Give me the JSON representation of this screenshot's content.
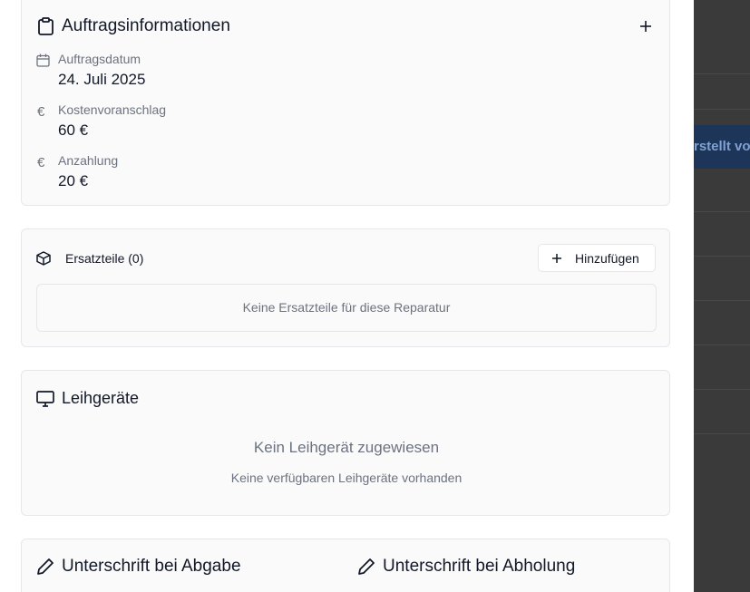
{
  "order_info": {
    "title": "Auftragsinformationen",
    "add_icon": "plus-icon",
    "fields": [
      {
        "icon": "calendar-icon",
        "label": "Auftragsdatum",
        "value": "24. Juli 2025"
      },
      {
        "icon": "euro-icon",
        "label": "Kostenvoranschlag",
        "value": "60 €"
      },
      {
        "icon": "euro-icon",
        "label": "Anzahlung",
        "value": "20 €"
      }
    ]
  },
  "spare_parts": {
    "title": "Ersatzteile (0)",
    "icon": "package-icon",
    "add_button": "Hinzufügen",
    "empty_text": "Keine Ersatzteile für diese Reparatur"
  },
  "loan_devices": {
    "title": "Leihgeräte",
    "icon": "monitor-icon",
    "empty_title": "Kein Leihgerät zugewiesen",
    "empty_subtitle": "Keine verfügbaren Leihgeräte vorhanden"
  },
  "signatures": {
    "dropoff_title": "Unterschrift bei Abgabe",
    "pickup_title": "Unterschrift bei Abholung",
    "icon": "pen-icon"
  },
  "background": {
    "highlight_text": "rstellt vo"
  },
  "colors": {
    "overlay": "#3a3a3a",
    "highlight_bg": "#1c3559",
    "highlight_text": "#7fa2d3",
    "muted_text": "#6b7280",
    "border": "#e5e7eb"
  }
}
